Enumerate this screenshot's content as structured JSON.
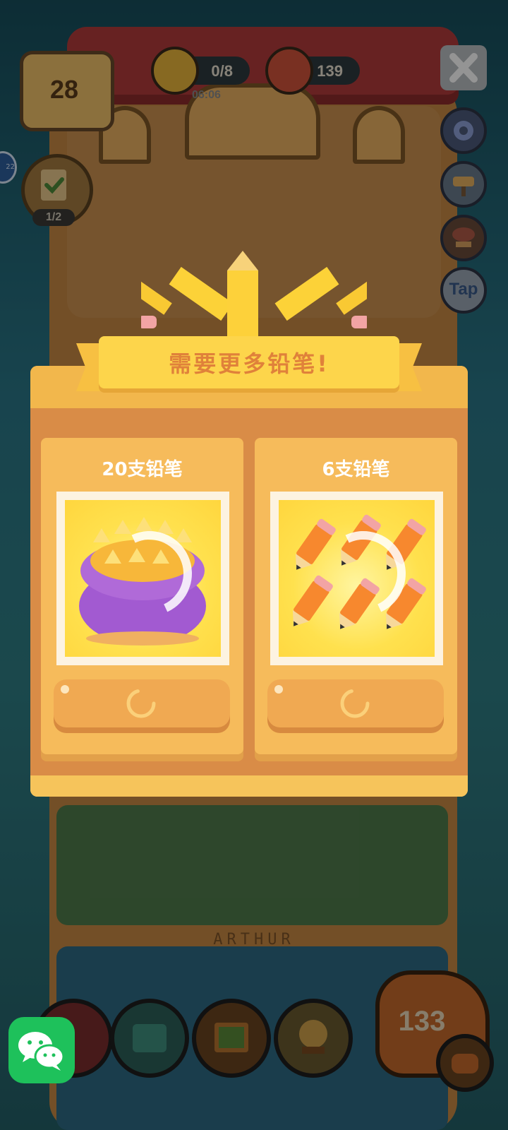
{
  "hud": {
    "level": "28",
    "pencils": "0/8",
    "timer": "06:06",
    "cans": "139",
    "task_progress": "1/2",
    "edge_badge": "22"
  },
  "side_buttons": {
    "tap_label": "Tap"
  },
  "dialog": {
    "title": "需要更多铅笔!",
    "cards": [
      {
        "title": "20支铅笔"
      },
      {
        "title": "6支铅笔"
      }
    ]
  },
  "room": {
    "nameplate": "ARTHUR"
  },
  "bottom": {
    "big_count": "133"
  },
  "colors": {
    "banner": "#fdd54b",
    "banner_text": "#e0813a",
    "card": "#f6bb5b",
    "button": "#f0a952",
    "wechat": "#1ec15b"
  }
}
